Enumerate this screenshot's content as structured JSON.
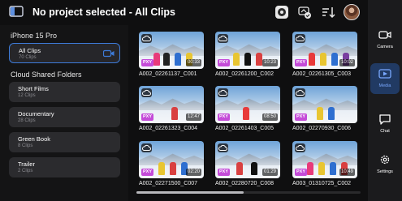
{
  "header": {
    "title": "No project selected - All Clips",
    "icons": [
      "sidebar-toggle-icon",
      "aperture-icon",
      "cloud-sync-icon",
      "sort-icon",
      "avatar"
    ]
  },
  "sidebar": {
    "device_title": "iPhone 15 Pro",
    "all_clips": {
      "name": "All Clips",
      "count": "70 Clips"
    },
    "shared_title": "Cloud Shared Folders",
    "folders": [
      {
        "name": "Short Films",
        "count": "12 Clips"
      },
      {
        "name": "Documentary",
        "count": "28 Clips"
      },
      {
        "name": "Green Book",
        "count": "8 Clips"
      },
      {
        "name": "Trailer",
        "count": "2 Clips"
      }
    ]
  },
  "clips": [
    {
      "name": "A002_02261137_C001",
      "duration": "00:33",
      "badge": "PXY"
    },
    {
      "name": "A002_02261200_C002",
      "duration": "10:23",
      "badge": "PXY"
    },
    {
      "name": "A002_02261305_C003",
      "duration": "10:02",
      "badge": "PXY"
    },
    {
      "name": "A002_02261323_C004",
      "duration": "12:47",
      "badge": "PXY"
    },
    {
      "name": "A002_02261403_C005",
      "duration": "08:50",
      "badge": "PXY"
    },
    {
      "name": "A002_02270930_C006",
      "duration": "",
      "badge": "PXY"
    },
    {
      "name": "A002_02271500_C007",
      "duration": "02:20",
      "badge": "PXY"
    },
    {
      "name": "A002_02280720_C008",
      "duration": "01:29",
      "badge": "PXY"
    },
    {
      "name": "A003_01310725_C002",
      "duration": "10:49",
      "badge": "PXY"
    }
  ],
  "nav": [
    {
      "label": "Camera",
      "icon": "camera-icon"
    },
    {
      "label": "Media",
      "icon": "media-icon"
    },
    {
      "label": "Chat",
      "icon": "chat-icon"
    },
    {
      "label": "Settings",
      "icon": "settings-icon"
    }
  ],
  "colors": {
    "accent": "#3d7bd9",
    "active_nav": "#213a63",
    "proxy_badge": "#c44bd8"
  }
}
